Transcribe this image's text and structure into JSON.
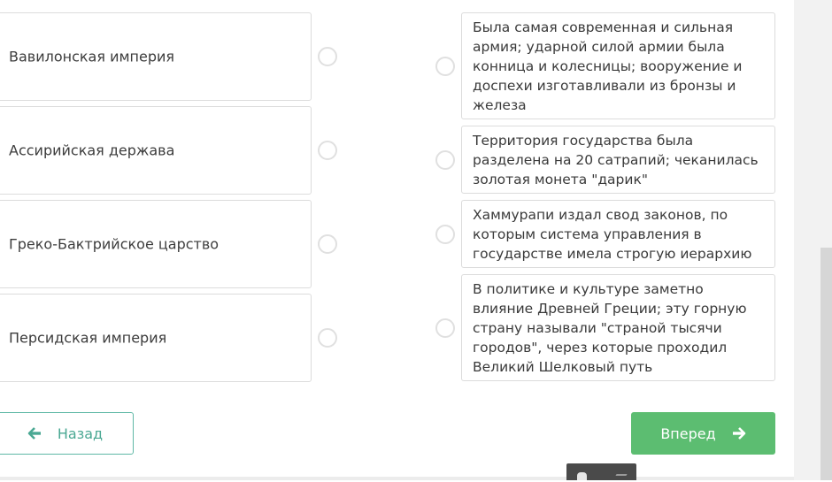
{
  "left_items": [
    {
      "label": "Вавилонская империя"
    },
    {
      "label": "Ассирийская держава"
    },
    {
      "label": "Греко-Бактрийское царство"
    },
    {
      "label": "Персидская империя"
    }
  ],
  "right_items": [
    {
      "text": "Была самая современная и сильная армия; ударной силой армии была конница и колесницы; вооружение и доспехи изготавливали из бронзы и железа"
    },
    {
      "text": "Территория государства была разделена на 20 сатрапий; чеканилась золотая монета \"дарик\""
    },
    {
      "text": "Хаммурапи издал свод законов, по которым система управления в государстве имела строгую иерархию"
    },
    {
      "text": "В политике и культуре заметно влияние Древней Греции; эту горную страну называли \"страной тысячи городов\", через которые проходил Великий Шелковый путь"
    }
  ],
  "nav": {
    "back_label": "Назад",
    "next_label": "Вперед"
  },
  "colors": {
    "back_accent": "#4aa893",
    "next_bg": "#5cbd71"
  },
  "icons": {
    "back": "arrow-left-icon",
    "next": "arrow-right-icon"
  }
}
